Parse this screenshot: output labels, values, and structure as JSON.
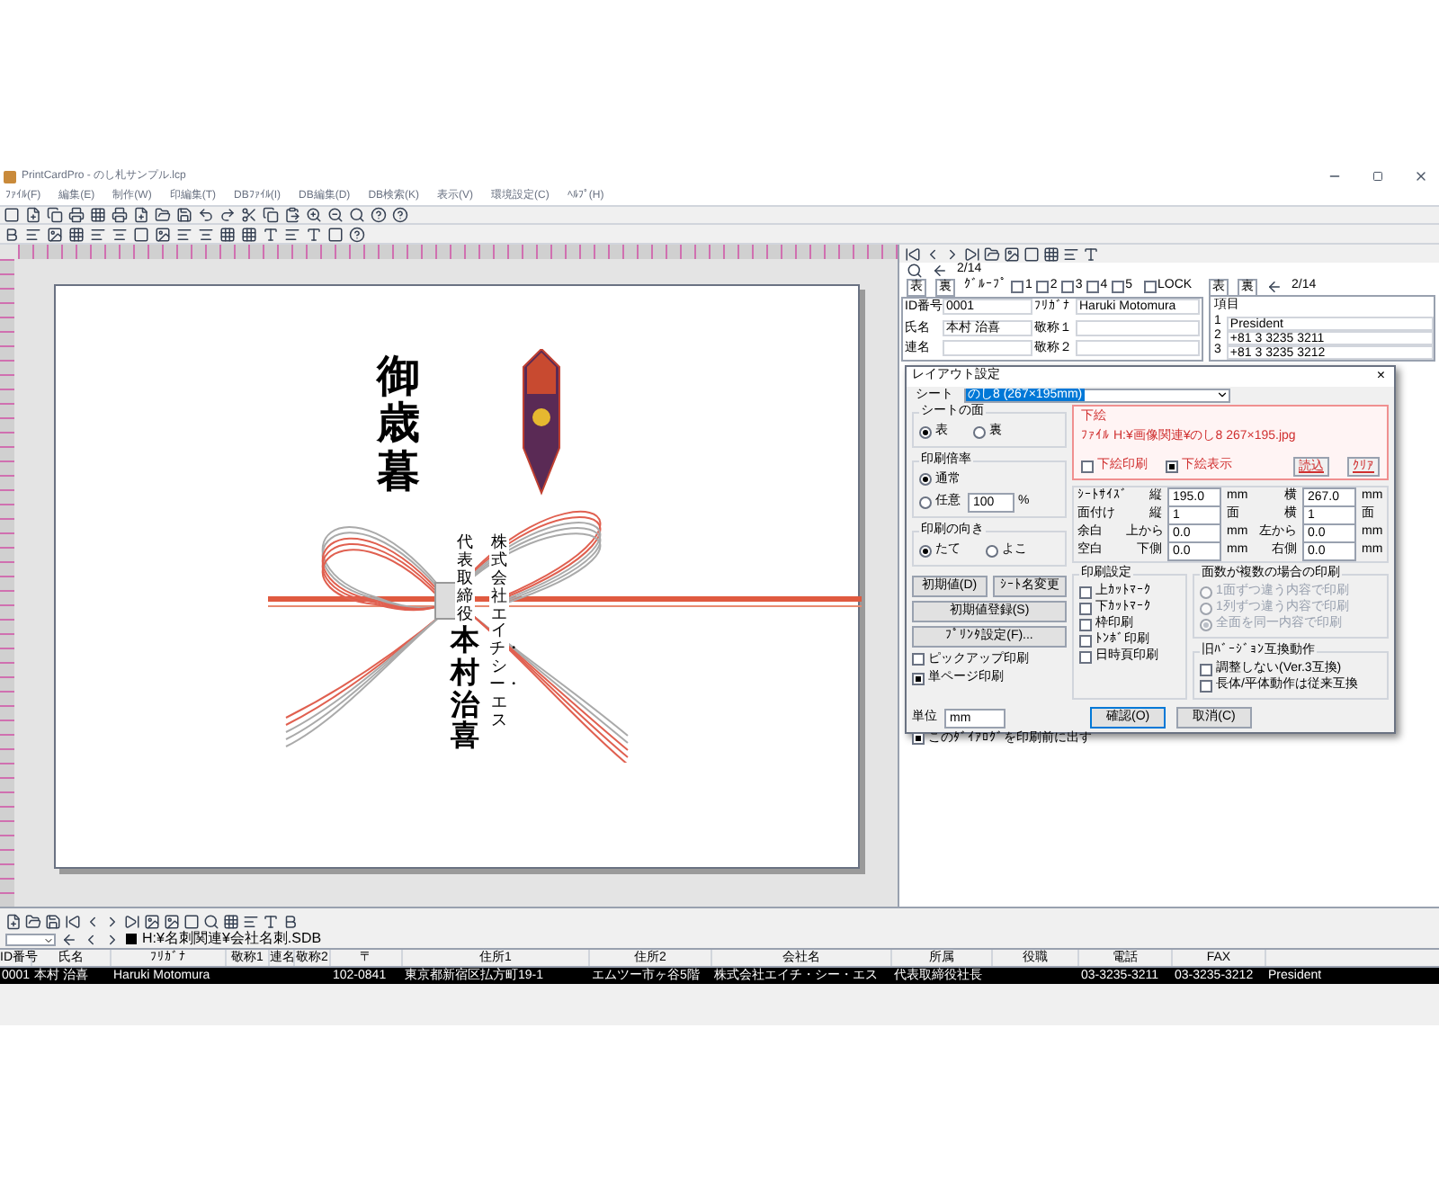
{
  "window": {
    "title": "PrintCardPro - のし札サンプル.lcp"
  },
  "menu": [
    "ﾌｧｲﾙ(F)",
    "編集(E)",
    "制作(W)",
    "印編集(T)",
    "DBﾌｧｲﾙ(I)",
    "DB編集(D)",
    "DB検索(K)",
    "表示(V)",
    "環境設定(C)",
    "ﾍﾙﾌﾟ(H)"
  ],
  "preview": {
    "greeting": "御歳暮",
    "company": "株式会社エイチ・シー・エス",
    "title": "代表取締役",
    "name": "本村治喜"
  },
  "record_panel": {
    "position": "2/14",
    "face_buttons": [
      "表",
      "裏"
    ],
    "group_label": "ｸﾞﾙｰﾌﾟ",
    "group_boxes": [
      {
        "label": "1",
        "checked": false
      },
      {
        "label": "2",
        "checked": false
      },
      {
        "label": "3",
        "checked": false
      },
      {
        "label": "4",
        "checked": false
      },
      {
        "label": "5",
        "checked": false
      }
    ],
    "lock": {
      "label": "LOCK",
      "checked": false
    },
    "fields": [
      {
        "label": "ID番号",
        "value": "0001"
      },
      {
        "label": "ﾌﾘｶﾞﾅ",
        "value": "Haruki  Motomura"
      },
      {
        "label": "氏名",
        "value": "本村  治喜"
      },
      {
        "label": "敬称１"
      },
      {
        "label": "連名"
      },
      {
        "label": "敬称２"
      }
    ]
  },
  "items_panel": {
    "face_buttons": [
      "表",
      "裏"
    ],
    "position": "2/14",
    "title": "項目",
    "rows": [
      {
        "no": "1",
        "value": "President"
      },
      {
        "no": "2",
        "value": "+81 3 3235 3211"
      },
      {
        "no": "3",
        "value": "+81 3 3235 3212"
      }
    ]
  },
  "dialog": {
    "title": "レイアウト設定",
    "close": "×",
    "sheet_label": "シート",
    "sheet_value": "のし8 (267×195mm)",
    "face_group": {
      "title": "シートの面",
      "options": [
        {
          "label": "表",
          "selected": true
        },
        {
          "label": "裏",
          "selected": false
        }
      ]
    },
    "scale_group": {
      "title": "印刷倍率",
      "options": [
        {
          "label": "通常",
          "selected": true
        },
        {
          "label": "任意",
          "selected": false
        }
      ],
      "value": "100",
      "unit": "%"
    },
    "orient_group": {
      "title": "印刷の向き",
      "options": [
        {
          "label": "たて",
          "selected": true
        },
        {
          "label": "よこ",
          "selected": false
        }
      ]
    },
    "buttons_left": [
      "初期値(D)",
      "ｼｰﾄ名変更"
    ],
    "register_button": "初期値登録(S)",
    "printer_button": "ﾌﾟﾘﾝﾀ設定(F)...",
    "print_checks": [
      {
        "label": "ピックアップ印刷",
        "checked": false
      },
      {
        "label": "単ページ印刷",
        "checked": true
      }
    ],
    "unit_label": "単位",
    "unit_value": "mm",
    "show_before": {
      "label": "このﾀﾞｲｱﾛｸﾞを印刷前に出す",
      "checked": true
    },
    "underlay": {
      "title": "下絵",
      "file": "ﾌｧｲﾙ H:¥画像関連¥のし8 267×195.jpg",
      "checks": [
        {
          "label": "下絵印刷",
          "checked": false
        },
        {
          "label": "下絵表示",
          "checked": true
        }
      ],
      "buttons": [
        "読込",
        "ｸﾘｱ"
      ]
    },
    "size_rows": [
      {
        "label": "ｼｰﾄｻｲｽﾞ",
        "a_label": "縦",
        "a_value": "195.0",
        "a_unit": "mm",
        "b_label": "横",
        "b_value": "267.0",
        "b_unit": "mm"
      },
      {
        "label": "面付け",
        "a_label": "縦",
        "a_value": "1",
        "a_unit": "面",
        "b_label": "横",
        "b_value": "1",
        "b_unit": "面"
      },
      {
        "label": "余白",
        "a_label": "上から",
        "a_value": "0.0",
        "a_unit": "mm",
        "b_label": "左から",
        "b_value": "0.0",
        "b_unit": "mm"
      },
      {
        "label": "空白",
        "a_label": "下側",
        "a_value": "0.0",
        "a_unit": "mm",
        "b_label": "右側",
        "b_value": "0.0",
        "b_unit": "mm"
      }
    ],
    "print_settings": {
      "title": "印刷設定",
      "checks": [
        {
          "label": "上ｶｯﾄﾏｰｸ",
          "checked": false
        },
        {
          "label": "下ｶｯﾄﾏｰｸ",
          "checked": false
        },
        {
          "label": "枠印刷",
          "checked": false
        },
        {
          "label": "ﾄﾝﾎﾞ印刷",
          "checked": false
        },
        {
          "label": "日時頁印刷",
          "checked": false
        }
      ]
    },
    "multi": {
      "title": "面数が複数の場合の印刷",
      "disabled": true,
      "options": [
        {
          "label": "1面ずつ違う内容で印刷",
          "selected": false
        },
        {
          "label": "1列ずつ違う内容で印刷",
          "selected": false
        },
        {
          "label": "全面を同一内容で印刷",
          "selected": true
        }
      ]
    },
    "legacy": {
      "title": "旧ﾊﾞｰｼﾞｮﾝ互換動作",
      "checks": [
        {
          "label": "調整しない(Ver.3互換)",
          "checked": false
        },
        {
          "label": "長体/平体動作は従来互換",
          "checked": false
        }
      ]
    },
    "ok": "確認(O)",
    "cancel": "取消(C)"
  },
  "db_path": "H:¥名刺関連¥会社名刺.SDB",
  "table": {
    "columns": [
      "ID番号",
      "氏名",
      "ﾌﾘｶﾞﾅ",
      "敬称1",
      "連名",
      "敬称2",
      "〒",
      "住所1",
      "住所2",
      "会社名",
      "所属",
      "役職",
      "電話",
      "FAX"
    ],
    "rows": [
      {
        "selected": true,
        "cells": [
          "0001",
          "本村 治喜",
          "Haruki  Motomura",
          "",
          "",
          "",
          "102-0841",
          "東京都新宿区払方町19-1",
          "エムツー市ヶ谷5階",
          "株式会社エイチ・シー・エス",
          "代表取締役社長",
          "",
          "03-3235-3211",
          "03-3235-3212",
          "President"
        ]
      }
    ]
  }
}
